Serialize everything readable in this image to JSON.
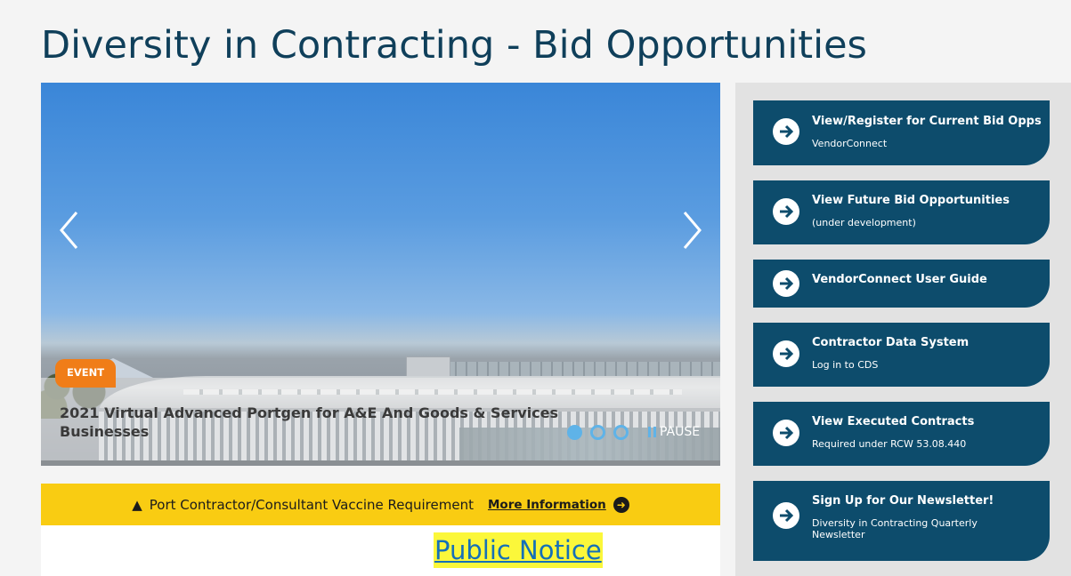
{
  "page": {
    "title": "Diversity in Contracting - Bid Opportunities"
  },
  "carousel": {
    "badge": "EVENT",
    "slide_title": "2021 Virtual Advanced Portgen for A&E And Goods & Services Businesses",
    "pause_label": "PAUSE",
    "slide_count": 3,
    "active_slide": 1
  },
  "alert": {
    "message": "Port Contractor/Consultant Vaccine Requirement",
    "link_label": "More Information"
  },
  "notice": {
    "label": "Public Notice"
  },
  "quick_links": [
    {
      "title": "View/Register for Current Bid Opps",
      "subtitle": "VendorConnect"
    },
    {
      "title": "View Future Bid Opportunities",
      "subtitle": "(under development)"
    },
    {
      "title": "VendorConnect User Guide",
      "subtitle": ""
    },
    {
      "title": "Contractor Data System",
      "subtitle": "Log in to CDS"
    },
    {
      "title": "View Executed Contracts",
      "subtitle": "Required under RCW 53.08.440"
    },
    {
      "title": "Sign Up for Our Newsletter!",
      "subtitle": "Diversity in Contracting Quarterly Newsletter"
    }
  ],
  "colors": {
    "title": "#0f3f5a",
    "link_panel": "#0d4c6c",
    "alert": "#f9cc12",
    "badge": "#f07d18",
    "carousel_dot": "#5fb3e8"
  }
}
